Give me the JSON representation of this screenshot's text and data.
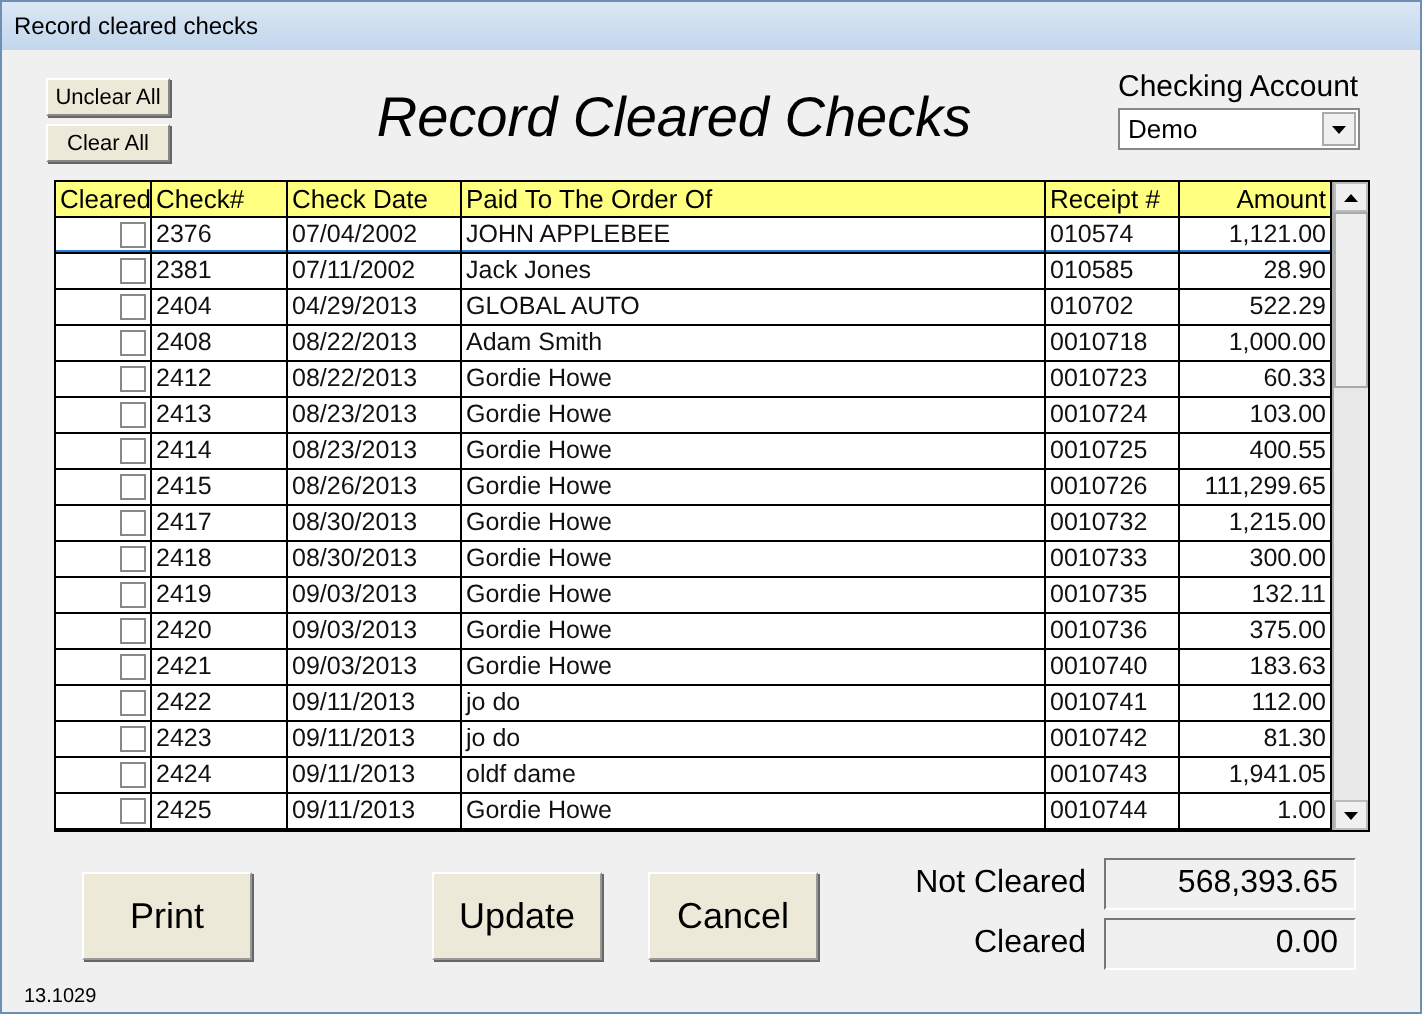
{
  "window": {
    "title": "Record cleared checks"
  },
  "buttons_left": [
    "Unclear All",
    "Clear All"
  ],
  "heading": "Record Cleared Checks",
  "account": {
    "label": "Checking Account",
    "value": "Demo"
  },
  "table": {
    "columns": [
      "Cleared",
      "Check#",
      "Check Date",
      "Paid To The Order Of",
      "Receipt #",
      "Amount"
    ],
    "rows": [
      {
        "checked": false,
        "selected": true,
        "check": "2376",
        "date": "07/04/2002",
        "payee": "JOHN APPLEBEE",
        "receipt": "010574",
        "amount": "1,121.00"
      },
      {
        "checked": false,
        "selected": false,
        "check": "2381",
        "date": "07/11/2002",
        "payee": "Jack Jones",
        "receipt": "010585",
        "amount": "28.90"
      },
      {
        "checked": false,
        "selected": false,
        "check": "2404",
        "date": "04/29/2013",
        "payee": "GLOBAL AUTO",
        "receipt": "010702",
        "amount": "522.29"
      },
      {
        "checked": false,
        "selected": false,
        "check": "2408",
        "date": "08/22/2013",
        "payee": "Adam Smith",
        "receipt": "0010718",
        "amount": "1,000.00"
      },
      {
        "checked": false,
        "selected": false,
        "check": "2412",
        "date": "08/22/2013",
        "payee": "Gordie Howe",
        "receipt": "0010723",
        "amount": "60.33"
      },
      {
        "checked": false,
        "selected": false,
        "check": "2413",
        "date": "08/23/2013",
        "payee": "Gordie Howe",
        "receipt": "0010724",
        "amount": "103.00"
      },
      {
        "checked": false,
        "selected": false,
        "check": "2414",
        "date": "08/23/2013",
        "payee": "Gordie Howe",
        "receipt": "0010725",
        "amount": "400.55"
      },
      {
        "checked": false,
        "selected": false,
        "check": "2415",
        "date": "08/26/2013",
        "payee": "Gordie Howe",
        "receipt": "0010726",
        "amount": "111,299.65"
      },
      {
        "checked": false,
        "selected": false,
        "check": "2417",
        "date": "08/30/2013",
        "payee": "Gordie Howe",
        "receipt": "0010732",
        "amount": "1,215.00"
      },
      {
        "checked": false,
        "selected": false,
        "check": "2418",
        "date": "08/30/2013",
        "payee": "Gordie Howe",
        "receipt": "0010733",
        "amount": "300.00"
      },
      {
        "checked": false,
        "selected": false,
        "check": "2419",
        "date": "09/03/2013",
        "payee": "Gordie Howe",
        "receipt": "0010735",
        "amount": "132.11"
      },
      {
        "checked": false,
        "selected": false,
        "check": "2420",
        "date": "09/03/2013",
        "payee": "Gordie Howe",
        "receipt": "0010736",
        "amount": "375.00"
      },
      {
        "checked": false,
        "selected": false,
        "check": "2421",
        "date": "09/03/2013",
        "payee": "Gordie Howe",
        "receipt": "0010740",
        "amount": "183.63"
      },
      {
        "checked": false,
        "selected": false,
        "check": "2422",
        "date": "09/11/2013",
        "payee": "jo do",
        "receipt": "0010741",
        "amount": "112.00"
      },
      {
        "checked": false,
        "selected": false,
        "check": "2423",
        "date": "09/11/2013",
        "payee": "jo do",
        "receipt": "0010742",
        "amount": "81.30"
      },
      {
        "checked": false,
        "selected": false,
        "check": "2424",
        "date": "09/11/2013",
        "payee": "oldf dame",
        "receipt": "0010743",
        "amount": "1,941.05"
      },
      {
        "checked": false,
        "selected": false,
        "check": "2425",
        "date": "09/11/2013",
        "payee": "Gordie Howe",
        "receipt": "0010744",
        "amount": "1.00"
      }
    ]
  },
  "buttons_bottom": [
    "Print",
    "Update",
    "Cancel"
  ],
  "totals": [
    {
      "label": "Not Cleared",
      "value": "568,393.65"
    },
    {
      "label": "Cleared",
      "value": "0.00"
    }
  ],
  "version": "13.1029"
}
